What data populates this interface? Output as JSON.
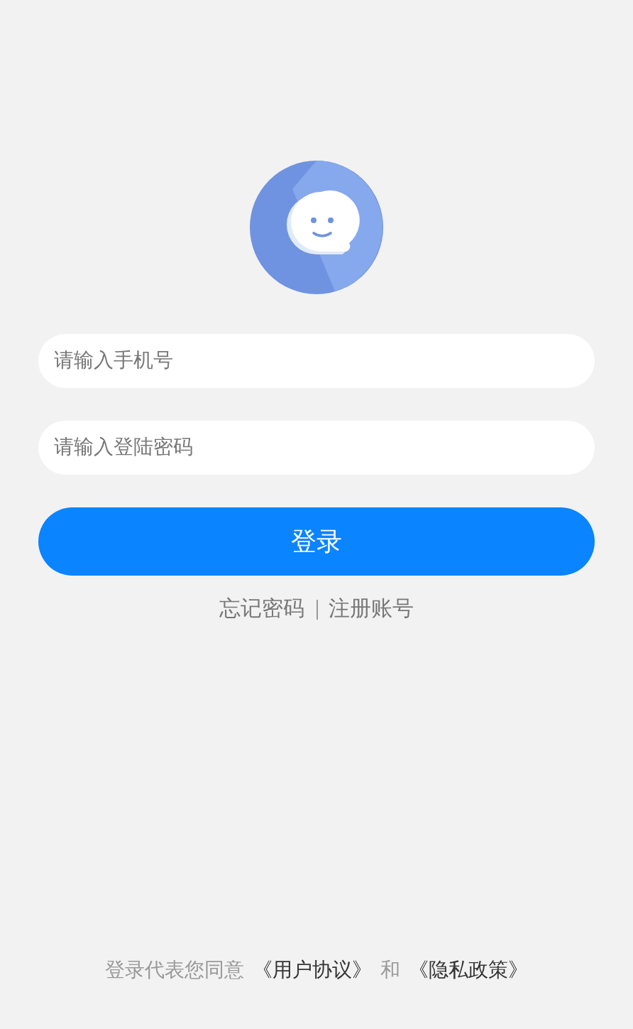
{
  "phone_field": {
    "placeholder": "请输入手机号"
  },
  "password_field": {
    "placeholder": "请输入登陆密码"
  },
  "login_button": {
    "label": "登录"
  },
  "links": [
    "忘记密码",
    "注册账号"
  ],
  "agreement": {
    "text": "登录代表您同意",
    "terms": "《用户协议》",
    "joiner": "和",
    "privacy": "《隐私政策》"
  }
}
